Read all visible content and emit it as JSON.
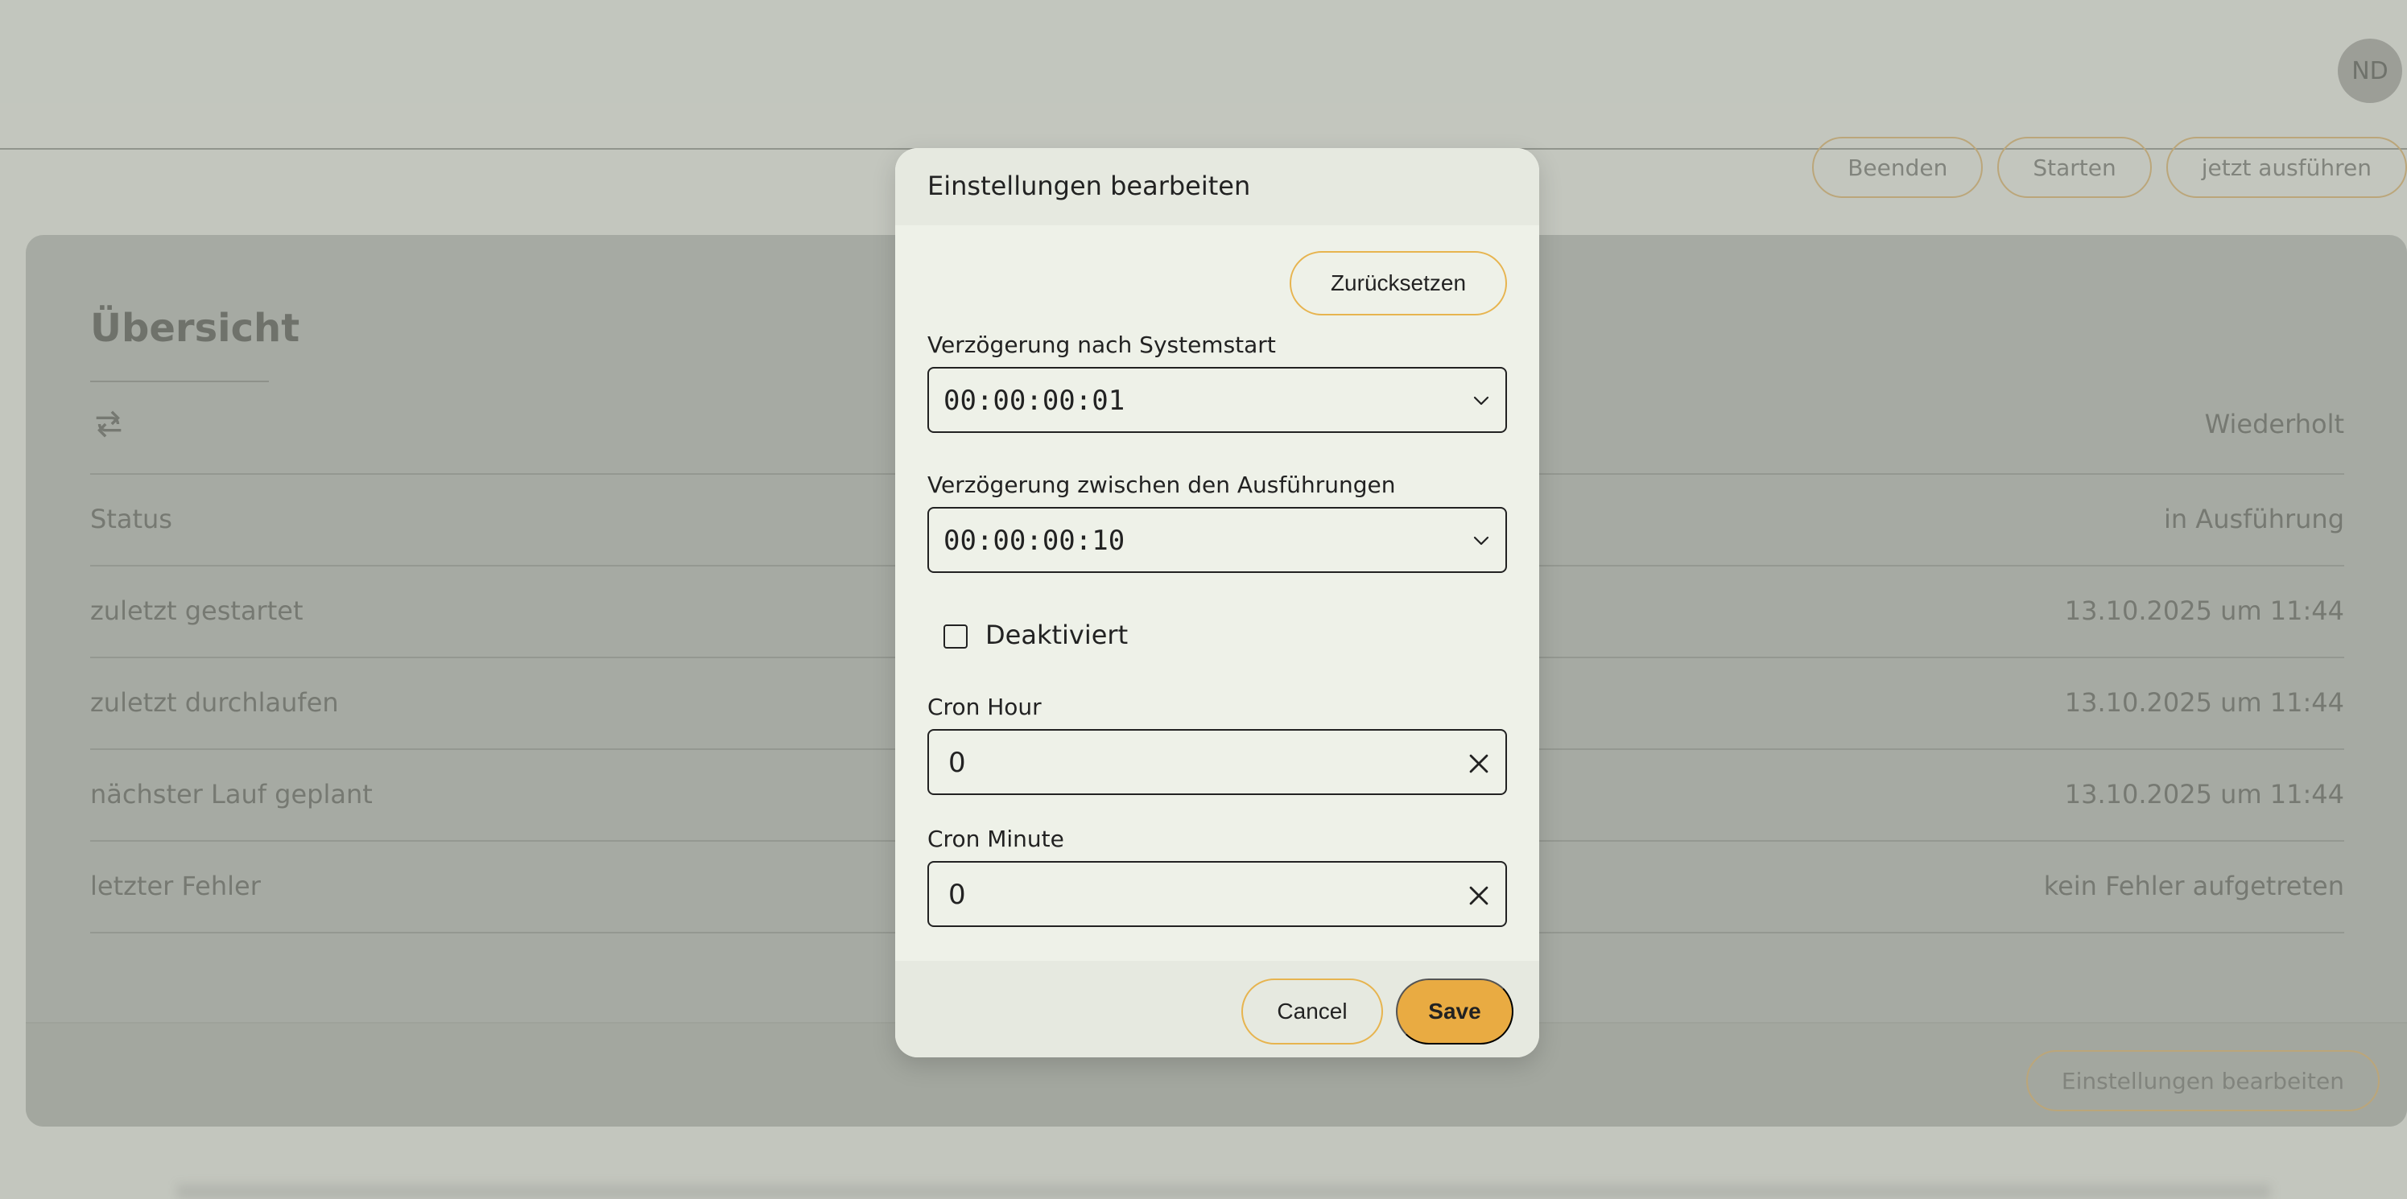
{
  "avatar": {
    "initials": "ND"
  },
  "actions": {
    "stop": "Beenden",
    "start": "Starten",
    "run_now": "jetzt ausführen"
  },
  "card": {
    "title": "Übersicht",
    "rows": [
      {
        "label": "",
        "value": "Wiederholt"
      },
      {
        "label": "Status",
        "value": "in Ausführung"
      },
      {
        "label": "zuletzt gestartet",
        "value": "13.10.2025 um 11:44"
      },
      {
        "label": "zuletzt durchlaufen",
        "value": "13.10.2025 um 11:44"
      },
      {
        "label": "nächster Lauf geplant",
        "value": "13.10.2025 um 11:44"
      },
      {
        "label": "letzter Fehler",
        "value": "kein Fehler aufgetreten"
      }
    ],
    "settings_button": "Einstellungen bearbeiten"
  },
  "modal": {
    "title": "Einstellungen bearbeiten",
    "reset": "Zurücksetzen",
    "delay_startup_label": "Verzögerung nach Systemstart",
    "delay_startup_value": "00:00:00:01",
    "delay_between_label": "Verzögerung zwischen den Ausführungen",
    "delay_between_value": "00:00:00:10",
    "disabled_label": "Deaktiviert",
    "cron_hour_label": "Cron Hour",
    "cron_hour_value": "0",
    "cron_minute_label": "Cron Minute",
    "cron_minute_value": "0",
    "cancel": "Cancel",
    "save": "Save"
  },
  "colors": {
    "accent": "#e9ab42",
    "accent_border": "#e7b44f",
    "page_background": "#eef1e8"
  },
  "icons": {
    "refresh": "refresh-icon",
    "chevron": "chevron-down-icon",
    "clear": "close-icon"
  }
}
